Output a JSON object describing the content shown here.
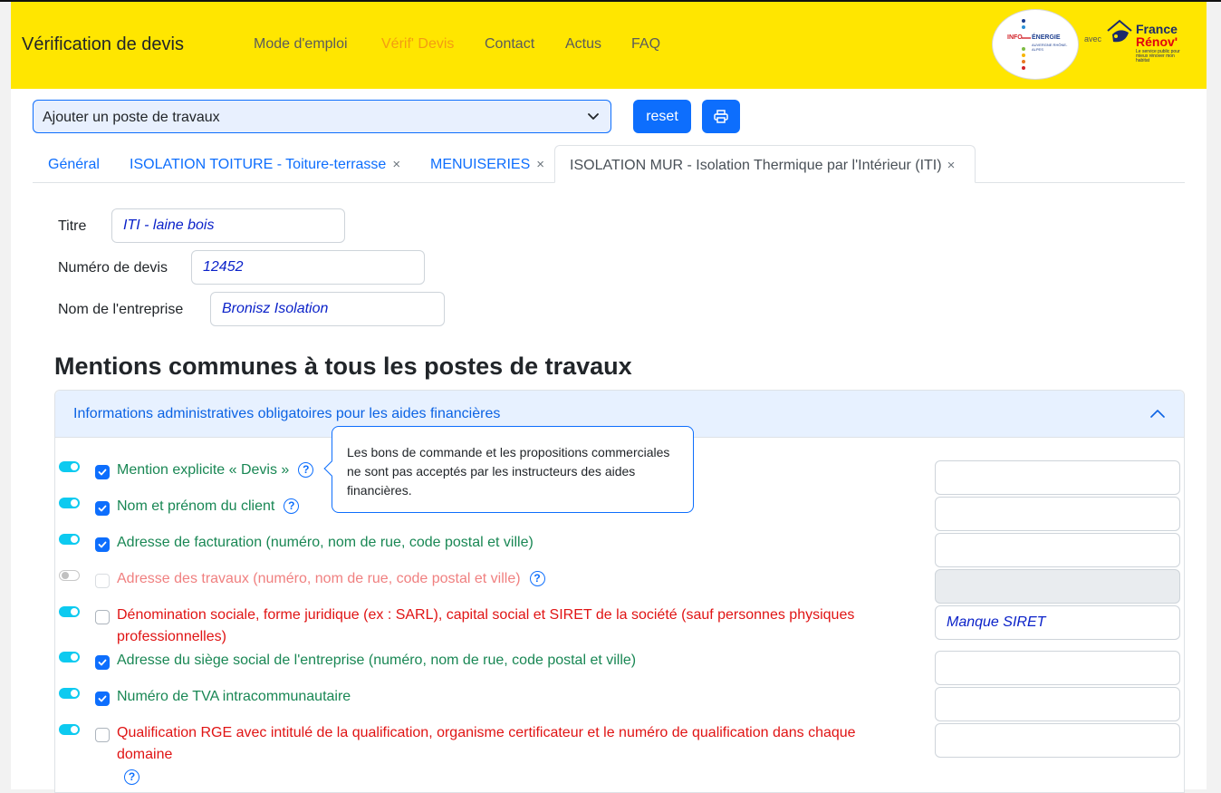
{
  "navbar": {
    "brand": "Vérification de devis",
    "links": [
      "Mode d'emploi",
      "Vérif' Devis",
      "Contact",
      "Actus",
      "FAQ"
    ],
    "active_index": 1,
    "avec": "avec",
    "logo_ie": {
      "part1": "INFO",
      "part2": "ÉNERGIE",
      "region": "AUVERGNE RHÔNE-ALPES"
    },
    "logo_france_renov": {
      "line1": "France",
      "line2": "Rénov'",
      "tagline": "Le service public pour mieux rénover mon habitat"
    }
  },
  "toolbar": {
    "select_value": "Ajouter un poste de travaux",
    "reset_label": "reset"
  },
  "tabs": [
    {
      "label": "Général",
      "closable": false
    },
    {
      "label": "ISOLATION TOITURE - Toiture-terrasse",
      "closable": true
    },
    {
      "label": "MENUISERIES",
      "closable": true
    },
    {
      "label": "ISOLATION MUR - Isolation Thermique par l'Intérieur (ITI)",
      "closable": true,
      "active": true
    }
  ],
  "close_symbol": "×",
  "form": {
    "titre_label": "Titre",
    "titre_value": "ITI - laine bois",
    "numero_label": "Numéro de devis",
    "numero_value": "12452",
    "entreprise_label": "Nom de l'entreprise",
    "entreprise_value": "Bronisz Isolation"
  },
  "section_title": "Mentions communes à tous les postes de travaux",
  "accordion": {
    "title": "Informations administratives obligatoires pour les aides financières",
    "expanded": true
  },
  "help_symbol": "?",
  "mentions": [
    {
      "text": "Mention explicite « Devis »",
      "switch": true,
      "checked": true,
      "status": "ok",
      "help": true,
      "comment": ""
    },
    {
      "text": "Nom et prénom du client",
      "switch": true,
      "checked": true,
      "status": "ok",
      "help": true,
      "comment": ""
    },
    {
      "text": "Adresse de facturation (numéro, nom de rue, code postal et ville)",
      "switch": true,
      "checked": true,
      "status": "ok",
      "help": false,
      "comment": ""
    },
    {
      "text": "Adresse des travaux (numéro, nom de rue, code postal et ville)",
      "switch": false,
      "checked": false,
      "status": "disabled",
      "help": true,
      "comment": ""
    },
    {
      "text": "Dénomination sociale, forme juridique (ex : SARL), capital social et SIRET de la société (sauf personnes physiques professionnelles)",
      "switch": true,
      "checked": false,
      "status": "missing",
      "help": false,
      "comment": "Manque SIRET"
    },
    {
      "text": "Adresse du siège social de l'entreprise (numéro, nom de rue, code postal et ville)",
      "switch": true,
      "checked": true,
      "status": "ok",
      "help": false,
      "comment": ""
    },
    {
      "text": "Numéro de TVA intracommunautaire",
      "switch": true,
      "checked": true,
      "status": "ok",
      "help": false,
      "comment": ""
    },
    {
      "text": "Qualification RGE avec intitulé de la qualification, organisme certificateur et le numéro de qualification dans chaque domaine",
      "switch": true,
      "checked": false,
      "status": "missing",
      "help": true,
      "comment": ""
    }
  ],
  "tooltip": {
    "text": "Les bons de commande et les propositions commerciales ne sont pas acceptés par les instructeurs des aides financières."
  },
  "colors": {
    "navbar": "#ffe600",
    "primary": "#0d6efd",
    "ok": "#198754",
    "missing": "#e01414",
    "switch_on": "#0dcaf0",
    "nav_active": "#f39c12"
  }
}
